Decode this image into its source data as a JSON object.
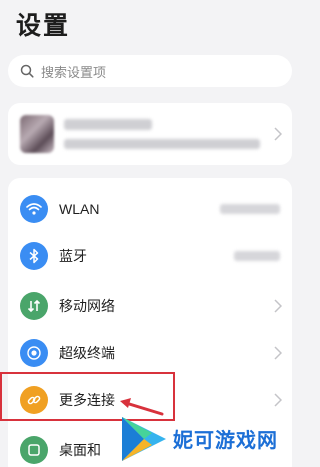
{
  "header": {
    "title": "设置"
  },
  "search": {
    "placeholder": "搜索设置项"
  },
  "settings": {
    "items": [
      {
        "label": "WLAN",
        "icon": "wifi-icon",
        "color": "#3a8df3"
      },
      {
        "label": "蓝牙",
        "icon": "bluetooth-icon",
        "color": "#3a8df3"
      },
      {
        "label": "移动网络",
        "icon": "mobile-network-icon",
        "color": "#4aa56a"
      },
      {
        "label": "超级终端",
        "icon": "super-device-icon",
        "color": "#3a8df3"
      },
      {
        "label": "更多连接",
        "icon": "link-icon",
        "color": "#f0a023"
      },
      {
        "label": "桌面和",
        "icon": "desktop-icon",
        "color": "#4aa56a"
      }
    ]
  },
  "watermark": {
    "text": "妮可游戏网"
  },
  "colors": {
    "highlight": "#d8323c",
    "brand": "#1c6fd6"
  }
}
